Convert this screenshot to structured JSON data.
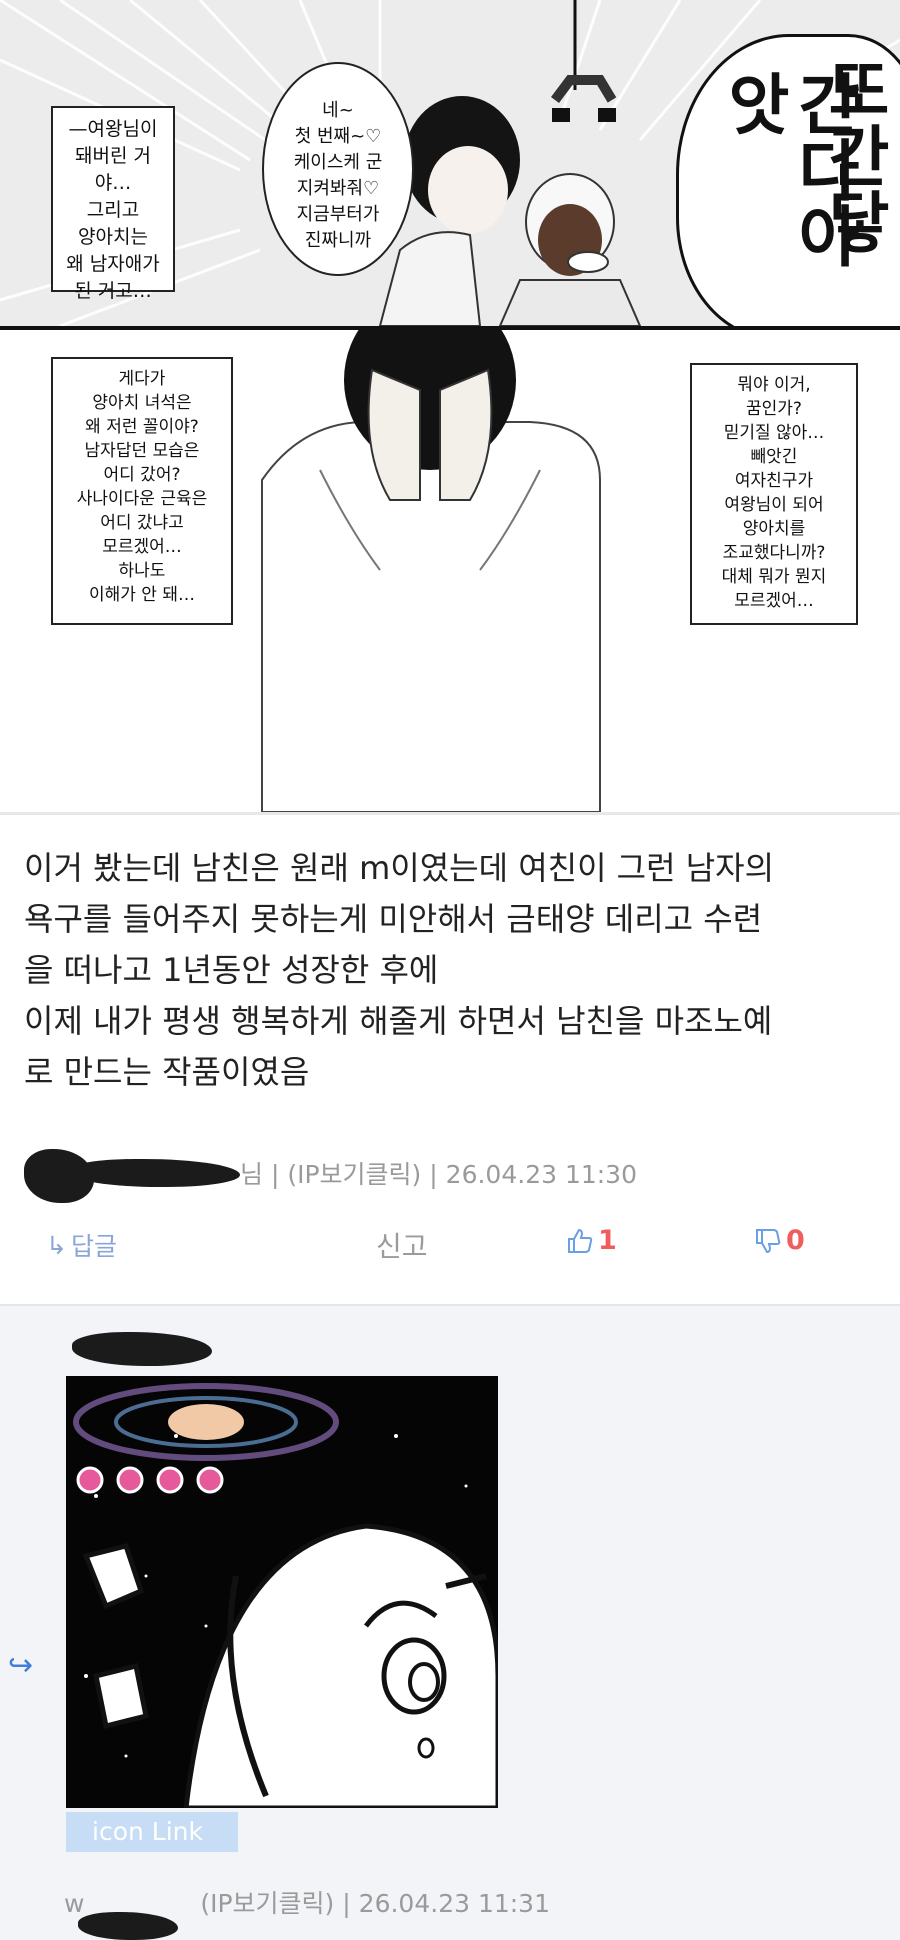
{
  "manga": {
    "top_caption": [
      "—여왕님이",
      "돼버린 거야…",
      "그리고",
      "양아치는",
      "왜 남자애가",
      "된 거고…"
    ],
    "speech_bubble": [
      "네~",
      "첫 번째~♡",
      "케이스케 군",
      "지켜봐줘♡",
      "지금부터가",
      "진짜니까"
    ],
    "sfx_columns": [
      "또간닿",
      "간다아앗"
    ],
    "left_caption": [
      "게다가",
      "양아치 녀석은",
      "왜 저런 꼴이야?",
      "남자답던 모습은",
      "어디 갔어?",
      "사나이다운 근육은",
      "어디 갔냐고",
      "모르겠어…",
      "하나도",
      "이해가 안 돼…"
    ],
    "right_caption": [
      "뭐야 이거,",
      "꿈인가?",
      "믿기질 않아…",
      "빼앗긴",
      "여자친구가",
      "여왕님이 되어",
      "양아치를",
      "조교했다니까?",
      "대체 뭐가 뭔지",
      "모르겠어…"
    ]
  },
  "comment1": {
    "lines": [
      "이거 봤는데 남친은 원래 m이였는데 여친이 그런 남자의",
      "욕구를 들어주지 못하는게 미안해서 금태양 데리고 수련",
      "을 떠나고 1년동안 성장한 후에",
      "이제 내가 평생 행복하게 해줄게 하면서 남친을 마조노예",
      "로 만드는 작품이였음"
    ],
    "author_tail": "님",
    "ip_label": "(IP보기클릭)",
    "sep": "|",
    "timestamp": "26.04.23 11:30",
    "reply_label": "답글",
    "report_label": "신고",
    "likes": "1",
    "dislikes": "0"
  },
  "comment2": {
    "author_partial": "w",
    "ip_label": "(IP보기클릭)",
    "sep": "|",
    "timestamp": "26.04.23 11:31",
    "icon_link_label": "icon Link"
  },
  "colors": {
    "accent_blue": "#3f7fd9",
    "vote_red": "#ef5d5d",
    "meta_gray": "#9a9a9a",
    "reply_bg": "#f2f4f7"
  },
  "icons": {
    "reply": "reply-arrow-icon",
    "like": "thumbs-up-icon",
    "dislike": "thumbs-down-icon"
  }
}
